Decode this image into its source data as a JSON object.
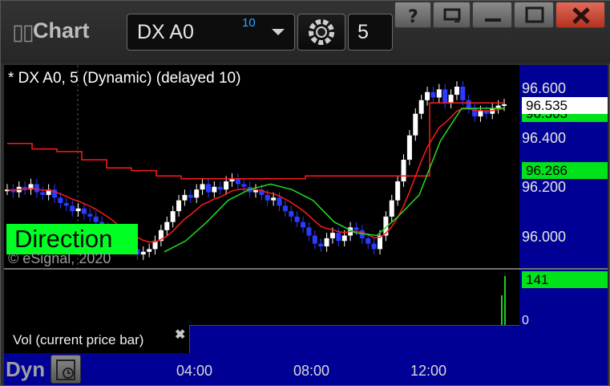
{
  "window": {
    "title": "Chart",
    "symbol": "DX A0",
    "symbol_delay_badge": "10",
    "interval": "5",
    "buttons": [
      "help-button",
      "window-link-button",
      "minimize-button",
      "maximize-button",
      "close-button"
    ]
  },
  "chart": {
    "study_label": "* DX A0, 5 (Dynamic) (delayed 10)",
    "direction_label": "Direction",
    "watermark": "© eSignal, 2020",
    "price_ticks": [
      "96.600",
      "96.400",
      "96.200",
      "96.000"
    ],
    "price_tags": {
      "last": "96.535",
      "hidden_green": "96.503",
      "green_line": "96.266"
    },
    "colors": {
      "background": "#000000",
      "scale_bg": "#000095",
      "up_candle": "#ffffff",
      "down_candle": "#2b3bff",
      "red_line": "#ff1a1a",
      "green_line": "#22dd22",
      "tag_green": "#00e21a"
    }
  },
  "volume": {
    "label": "Vol (current price bar)",
    "close_icon": "x-icon",
    "value_tag": "141",
    "zero_tick": "0"
  },
  "xaxis": {
    "dyn_label": "Dyn",
    "ticks": [
      "04:00",
      "08:00",
      "12:00"
    ]
  },
  "chart_data": {
    "type": "candlestick",
    "series": [
      {
        "name": "",
        "ohlc_close": [
          96.22,
          96.21,
          96.23,
          96.22,
          96.24,
          96.21,
          96.2,
          96.22,
          96.19,
          96.17,
          96.16,
          96.14,
          96.15,
          96.13,
          96.12,
          96.1,
          96.08,
          96.06,
          96.04,
          96.01,
          96.03,
          96.0,
          95.98,
          95.99,
          96.0,
          96.03,
          96.07,
          96.1,
          96.14,
          96.18,
          96.2,
          96.19,
          96.22,
          96.24,
          96.21,
          96.23,
          96.22,
          96.25,
          96.26,
          96.24,
          96.23,
          96.21,
          96.22,
          96.2,
          96.18,
          96.19,
          96.16,
          96.14,
          96.12,
          96.1,
          96.08,
          96.05,
          96.02,
          96.01,
          96.04,
          96.06,
          96.03,
          96.05,
          96.08,
          96.07,
          96.04,
          96.02,
          96.0,
          96.05,
          96.12,
          96.18,
          96.25,
          96.33,
          96.42,
          96.5,
          96.55,
          96.58,
          96.56,
          96.59,
          96.54,
          96.57,
          96.6,
          96.55,
          96.52,
          96.49,
          96.51,
          96.5,
          96.52,
          96.53,
          96.535
        ]
      }
    ],
    "indicators": [
      {
        "name": "",
        "color": "red",
        "values": [
          96.39,
          96.37,
          96.36,
          96.33,
          96.3,
          96.29,
          96.27,
          96.26,
          96.26,
          96.26,
          96.26,
          96.26,
          96.27,
          96.27,
          96.27,
          96.27,
          96.27,
          96.54,
          96.54,
          96.54
        ]
      },
      {
        "name": "",
        "color": "green",
        "values": [
          95.99,
          96.03,
          96.1,
          96.18,
          96.22,
          96.24,
          96.22,
          96.18,
          96.1,
          96.06,
          96.05,
          96.12,
          96.2,
          96.4,
          96.52,
          96.52,
          96.52
        ]
      }
    ],
    "volume_last": 141,
    "y_ticks": [
      96.6,
      96.4,
      96.2,
      96.0
    ],
    "ylim": [
      95.93,
      96.68
    ],
    "x_ticks": [
      "04:00",
      "08:00",
      "12:00"
    ],
    "grid": false
  }
}
